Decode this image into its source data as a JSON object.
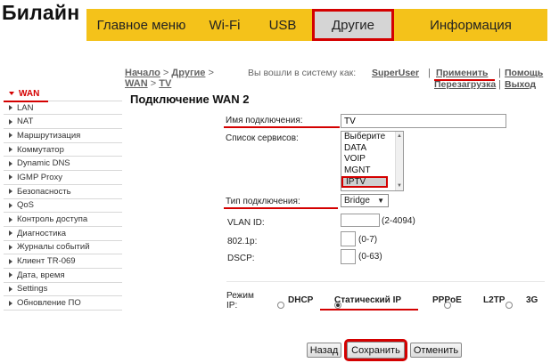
{
  "brand": {
    "logo_text": "Билайн"
  },
  "topnav": {
    "tabs": [
      {
        "label": "Главное меню"
      },
      {
        "label": "Wi-Fi"
      },
      {
        "label": "USB"
      },
      {
        "label": "Другие"
      },
      {
        "label": "Информация"
      }
    ],
    "active": "Другие"
  },
  "breadcrumb": {
    "home": "Начало",
    "other": "Другие",
    "wan": "WAN",
    "tv": "TV",
    "sep": ">"
  },
  "session": {
    "logged_in_text": "Вы вошли в систему как:",
    "user": "SuperUser",
    "apply": "Применить",
    "help": "Помощь",
    "reboot": "Перезагрузка",
    "logout": "Выход",
    "sep": "|"
  },
  "sidebar": {
    "items": [
      {
        "label": "WAN",
        "active": true
      },
      {
        "label": "LAN"
      },
      {
        "label": "NAT"
      },
      {
        "label": "Маршрутизация"
      },
      {
        "label": "Коммутатор"
      },
      {
        "label": "Dynamic DNS"
      },
      {
        "label": "IGMP Proxy"
      },
      {
        "label": "Безопасность"
      },
      {
        "label": "QoS"
      },
      {
        "label": "Контроль доступа"
      },
      {
        "label": "Диагностика"
      },
      {
        "label": "Журналы событий"
      },
      {
        "label": "Клиент TR-069"
      },
      {
        "label": "Дата, время"
      },
      {
        "label": "Settings"
      },
      {
        "label": "Обновление ПО"
      }
    ]
  },
  "page": {
    "title": "Подключение WAN 2"
  },
  "form": {
    "conn_name_label": "Имя подключения:",
    "conn_name_value": "TV",
    "services_label": "Список сервисов:",
    "services": [
      "Выберите",
      "DATA",
      "VOIP",
      "MGNT",
      "IPTV"
    ],
    "services_selected": "IPTV",
    "conn_type_label": "Тип подключения:",
    "conn_type_value": "Bridge",
    "vlan_label": "VLAN ID:",
    "vlan_value": "",
    "vlan_hint": "(2-4094)",
    "p8021_label": "802.1p:",
    "p8021_value": "",
    "p8021_hint": "(0-7)",
    "dscp_label": "DSCP:",
    "dscp_value": "",
    "dscp_hint": "(0-63)",
    "ip_mode_label_1": "Режим",
    "ip_mode_label_2": "IP:",
    "ip_modes": [
      "DHCP",
      "Статический IP",
      "PPPoE",
      "L2TP",
      "3G"
    ],
    "ip_mode_selected": "Статический IP"
  },
  "buttons": {
    "back": "Назад",
    "save": "Сохранить",
    "cancel": "Отменить"
  },
  "colors": {
    "accent": "#f4c21a",
    "highlight": "#d40000"
  }
}
